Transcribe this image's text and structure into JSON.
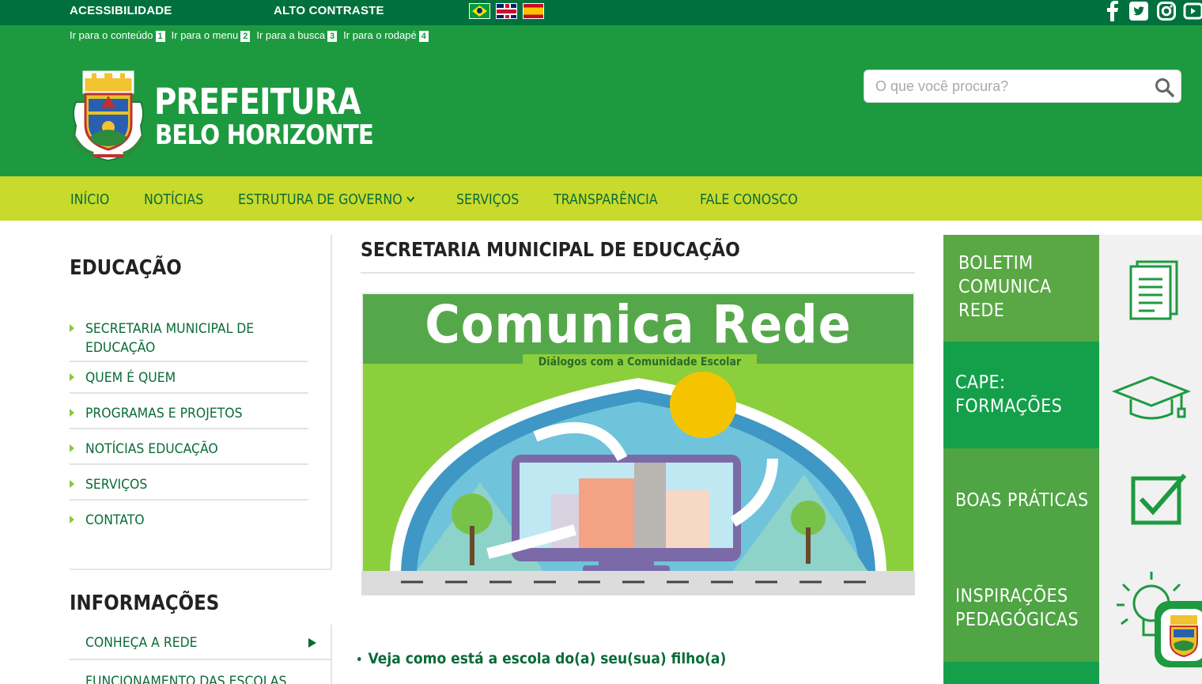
{
  "topbar": {
    "accessibility_label": "ACESSIBILIDADE",
    "contrast_label": "ALTO CONTRASTE",
    "languages": [
      "Português",
      "English",
      "Español"
    ],
    "social": [
      "facebook-icon",
      "twitter-icon",
      "instagram-icon",
      "youtube-icon"
    ]
  },
  "skip_links": [
    {
      "label": "Ir para o conteúdo",
      "key": "1"
    },
    {
      "label": "Ir para o menu",
      "key": "2"
    },
    {
      "label": "Ir para a busca",
      "key": "3"
    },
    {
      "label": "Ir para o rodapé",
      "key": "4"
    }
  ],
  "brand": {
    "line1": "PREFEITURA",
    "line2": "BELO HORIZONTE"
  },
  "search": {
    "placeholder": "O que você procura?",
    "value": ""
  },
  "nav": {
    "items": [
      "INÍCIO",
      "NOTÍCIAS",
      "ESTRUTURA DE GOVERNO",
      "SERVIÇOS",
      "TRANSPARÊNCIA",
      "FALE CONOSCO"
    ]
  },
  "sidebar": {
    "title": "EDUCAÇÃO",
    "items": [
      "SECRETARIA MUNICIPAL DE EDUCAÇÃO",
      "QUEM É QUEM",
      "PROGRAMAS E PROJETOS",
      "NOTÍCIAS EDUCAÇÃO",
      "SERVIÇOS",
      "CONTATO"
    ],
    "info_title": "INFORMAÇÕES",
    "info_items": [
      "CONHEÇA A REDE",
      "FUNCIONAMENTO DAS ESCOLAS"
    ]
  },
  "main": {
    "title": "SECRETARIA MUNICIPAL DE EDUCAÇÃO",
    "banner_title": "Comunica Rede",
    "banner_subtitle": "Diálogos com a Comunidade Escolar",
    "bullet": "Veja como está a escola do(a) seu(sua) filho(a)"
  },
  "tiles": [
    {
      "lines": [
        "BOLETIM",
        "COMUNICA",
        "REDE"
      ],
      "icon": "document-icon",
      "color": "#5aa845"
    },
    {
      "lines": [
        "CAPE:",
        "FORMAÇÕES"
      ],
      "icon": "graduation-cap-icon",
      "color": "#14a04b"
    },
    {
      "lines": [
        "BOAS PRÁTICAS"
      ],
      "icon": "checkbox-icon",
      "color": "#4fa444"
    },
    {
      "lines": [
        "INSPIRAÇÕES",
        "PEDAGÓGICAS"
      ],
      "icon": "lightbulb-icon",
      "color": "#4fa444"
    }
  ],
  "colors": {
    "topbar": "#00703c",
    "header": "#1d9a40",
    "nav": "#c8da2b",
    "link": "#0a6b38"
  }
}
